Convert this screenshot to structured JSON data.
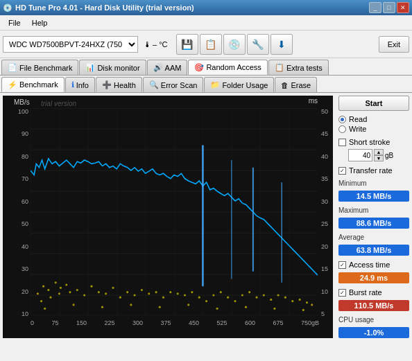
{
  "titlebar": {
    "title": "HD Tune Pro 4.01 - Hard Disk Utility (trial version)",
    "icon": "💿"
  },
  "menubar": {
    "items": [
      "File",
      "Help"
    ]
  },
  "toolbar": {
    "drive": "WDC WD7500BPVT-24HXZ  (750 gB)",
    "temp_icon": "🌡",
    "temp_value": "– °C",
    "exit_label": "Exit"
  },
  "tabs_row1": [
    {
      "label": "File Benchmark",
      "icon": "📄"
    },
    {
      "label": "Disk monitor",
      "icon": "📊"
    },
    {
      "label": "AAM",
      "icon": "🔊"
    },
    {
      "label": "Random Access",
      "icon": "🎯",
      "active": true
    },
    {
      "label": "Extra tests",
      "icon": "📋"
    }
  ],
  "tabs_row2": [
    {
      "label": "Benchmark",
      "icon": "⚡",
      "active": true
    },
    {
      "label": "Info",
      "icon": "ℹ"
    },
    {
      "label": "Health",
      "icon": "➕"
    },
    {
      "label": "Error Scan",
      "icon": "🔍"
    },
    {
      "label": "Folder Usage",
      "icon": "📁"
    },
    {
      "label": "Erase",
      "icon": "🗑"
    }
  ],
  "chart": {
    "y_left_labels": [
      "100",
      "90",
      "80",
      "70",
      "60",
      "50",
      "40",
      "30",
      "20",
      "10"
    ],
    "y_right_labels": [
      "50",
      "45",
      "40",
      "35",
      "30",
      "25",
      "20",
      "15",
      "10",
      "5"
    ],
    "x_labels": [
      "0",
      "75",
      "150",
      "225",
      "300",
      "375",
      "450",
      "525",
      "600",
      "675",
      "750gB"
    ],
    "label_mbs": "MB/s",
    "label_ms": "ms",
    "trial_text": "trial version"
  },
  "right_panel": {
    "start_label": "Start",
    "radio_options": [
      {
        "label": "Read",
        "selected": true
      },
      {
        "label": "Write",
        "selected": false
      }
    ],
    "short_stroke_label": "Short stroke",
    "short_stroke_checked": false,
    "stroke_value": "40",
    "stroke_unit": "gB",
    "transfer_rate_label": "Transfer rate",
    "transfer_rate_checked": true,
    "minimum_label": "Minimum",
    "minimum_value": "14.5 MB/s",
    "maximum_label": "Maximum",
    "maximum_value": "88.6 MB/s",
    "average_label": "Average",
    "average_value": "63.8 MB/s",
    "access_time_label": "Access time",
    "access_time_checked": true,
    "access_time_value": "24.9 ms",
    "burst_rate_label": "Burst rate",
    "burst_rate_checked": true,
    "burst_rate_value": "110.5 MB/s",
    "cpu_usage_label": "CPU usage",
    "cpu_usage_value": "-1.0%"
  }
}
